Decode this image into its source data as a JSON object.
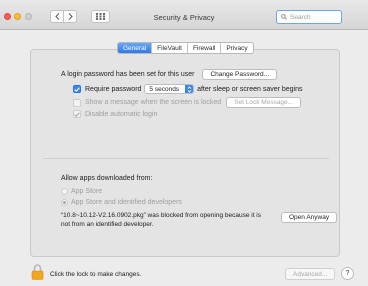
{
  "window": {
    "title": "Security & Privacy",
    "search_placeholder": "Search"
  },
  "tabs": [
    {
      "label": "General",
      "active": true
    },
    {
      "label": "FileVault",
      "active": false
    },
    {
      "label": "Firewall",
      "active": false
    },
    {
      "label": "Privacy",
      "active": false
    }
  ],
  "general": {
    "login_password_text": "A login password has been set for this user",
    "change_password_button": "Change Password...",
    "require_password": {
      "checked": true,
      "label": "Require password",
      "delay_value": "5 seconds",
      "suffix": "after sleep or screen saver begins"
    },
    "show_message": {
      "checked": false,
      "label": "Show a message when the screen is locked",
      "button": "Set Lock Message..."
    },
    "disable_auto_login": {
      "checked": true,
      "label": "Disable automatic login"
    }
  },
  "downloads": {
    "heading": "Allow apps downloaded from:",
    "options": [
      {
        "label": "App Store",
        "selected": false
      },
      {
        "label": "App Store and identified developers",
        "selected": true
      }
    ],
    "blocked_message": "“10.8~10.12-V2.16.0902.pkg” was blocked from opening because it is not from an identified developer.",
    "open_anyway_button": "Open Anyway"
  },
  "footer": {
    "lock_label": "Click the lock to make changes.",
    "advanced_button": "Advanced...",
    "help_label": "?"
  },
  "colors": {
    "accent": "#3b87ee",
    "lock": "#f2a51f"
  }
}
